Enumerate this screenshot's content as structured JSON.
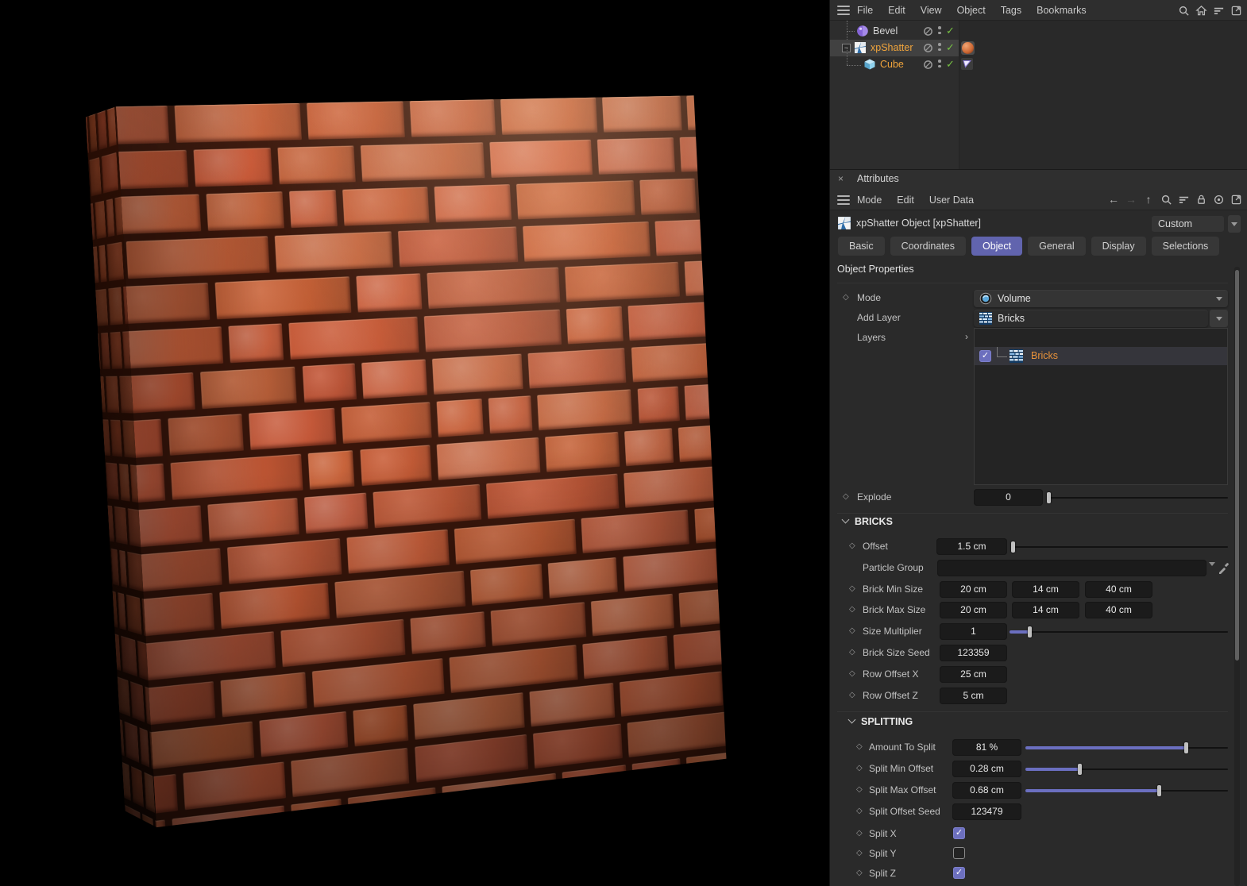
{
  "viewport": {
    "content": "3D render of a red brick wall on black background",
    "wall_colors": {
      "brick": "#b95c3a",
      "mortar": "#38150a",
      "highlight": "#e08a60"
    }
  },
  "object_manager": {
    "menu": {
      "items": [
        "File",
        "Edit",
        "View",
        "Object",
        "Tags",
        "Bookmarks"
      ]
    },
    "objects": [
      {
        "name": "Bevel"
      },
      {
        "name": "xpShatter"
      },
      {
        "name": "Cube"
      }
    ]
  },
  "attributes": {
    "panel_title": "Attributes",
    "close_glyph": "×",
    "menu": {
      "items": [
        "Mode",
        "Edit",
        "User Data"
      ]
    },
    "nav": {
      "back": "←",
      "forward": "→",
      "up": "↑"
    },
    "object_title": "xpShatter Object [xpShatter]",
    "preset": "Custom",
    "tabs": [
      "Basic",
      "Coordinates",
      "Object",
      "General",
      "Display",
      "Selections"
    ],
    "active_tab": "Object",
    "heading": "Object Properties",
    "props": {
      "mode": {
        "label": "Mode",
        "value": "Volume"
      },
      "add_layer": {
        "label": "Add Layer",
        "value": "Bricks"
      },
      "layers": {
        "label": "Layers",
        "items": [
          {
            "name": "Bricks",
            "checked": true
          }
        ]
      },
      "explode": {
        "label": "Explode",
        "value": "0"
      },
      "bricks_section": "BRICKS",
      "offset": {
        "label": "Offset",
        "value": "1.5 cm"
      },
      "particle_group": {
        "label": "Particle Group",
        "value": ""
      },
      "brick_min_size": {
        "label": "Brick Min Size",
        "values": [
          "20 cm",
          "14 cm",
          "40 cm"
        ]
      },
      "brick_max_size": {
        "label": "Brick Max Size",
        "values": [
          "20 cm",
          "14 cm",
          "40 cm"
        ]
      },
      "size_multiplier": {
        "label": "Size Multiplier",
        "value": "1"
      },
      "brick_size_seed": {
        "label": "Brick Size Seed",
        "value": "123359"
      },
      "row_offset_x": {
        "label": "Row Offset X",
        "value": "25 cm"
      },
      "row_offset_z": {
        "label": "Row Offset Z",
        "value": "5 cm"
      },
      "splitting_section": "SPLITTING",
      "amount_to_split": {
        "label": "Amount To Split",
        "value": "81 %"
      },
      "split_min_offset": {
        "label": "Split Min Offset",
        "value": "0.28 cm"
      },
      "split_max_offset": {
        "label": "Split Max Offset",
        "value": "0.68 cm"
      },
      "split_offset_seed": {
        "label": "Split Offset Seed",
        "value": "123479"
      },
      "split_x": {
        "label": "Split X",
        "checked": true
      },
      "split_y": {
        "label": "Split Y",
        "checked": false
      },
      "split_z": {
        "label": "Split Z",
        "checked": true
      }
    }
  },
  "colors": {
    "accent": "#6164ae",
    "selected_text": "#f0a43c",
    "check_green": "#76c043",
    "slider_fill": "#6b6fc0"
  }
}
